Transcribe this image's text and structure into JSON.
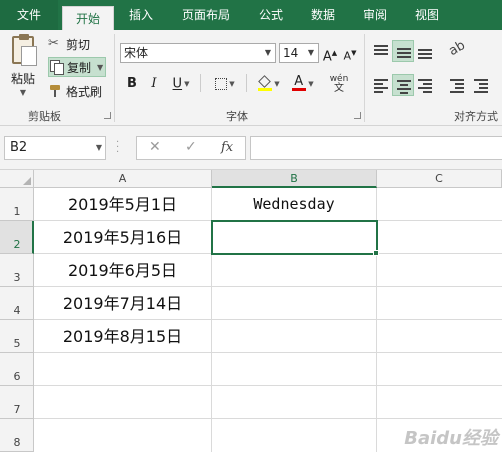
{
  "tabs": [
    {
      "label": "文件"
    },
    {
      "label": "开始"
    },
    {
      "label": "插入"
    },
    {
      "label": "页面布局"
    },
    {
      "label": "公式"
    },
    {
      "label": "数据"
    },
    {
      "label": "审阅"
    },
    {
      "label": "视图"
    }
  ],
  "clipboard": {
    "paste_label": "粘贴",
    "cut_label": "剪切",
    "copy_label": "复制",
    "format_painter_label": "格式刷",
    "group_label": "剪贴板"
  },
  "font": {
    "family": "宋体",
    "size": "14",
    "increase_label": "A",
    "decrease_label": "A",
    "bold_label": "B",
    "italic_label": "I",
    "underline_label": "U",
    "fill_label": "",
    "color_label": "A",
    "phonetic_top": "wén",
    "phonetic_bottom": "文",
    "group_label": "字体"
  },
  "alignment": {
    "group_label": "对齐方式"
  },
  "formula_bar": {
    "name_box": "B2",
    "cancel_icon": "✕",
    "enter_icon": "✓",
    "fx_label": "fx",
    "value": ""
  },
  "grid": {
    "columns": [
      "A",
      "B",
      "C"
    ],
    "rows": [
      "1",
      "2",
      "3",
      "4",
      "5",
      "6",
      "7",
      "8"
    ],
    "cells": {
      "A1": "2019年5月1日",
      "A2": "2019年5月16日",
      "A3": "2019年6月5日",
      "A4": "2019年7月14日",
      "A5": "2019年8月15日",
      "B1": "Wednesday"
    },
    "active_cell": "B2"
  },
  "watermark": "Baidu经验",
  "colors": {
    "accent": "#217346",
    "selection_fill": "#c6e0cf"
  }
}
